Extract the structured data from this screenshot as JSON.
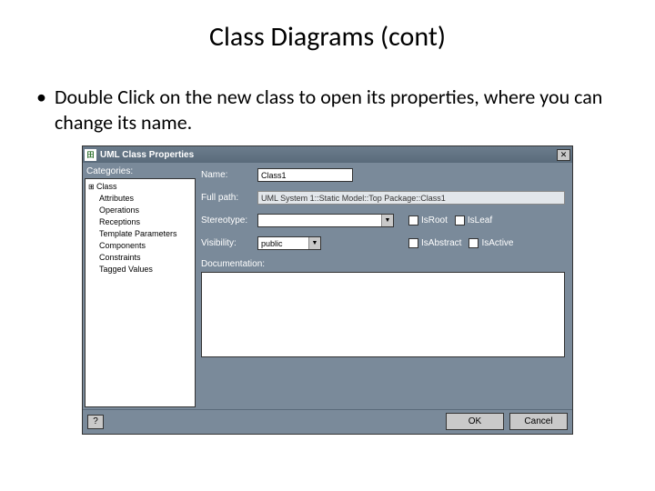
{
  "slide": {
    "title": "Class Diagrams (cont)",
    "bullet": "Double Click on the new class to open its properties, where you can change its name."
  },
  "dialog": {
    "title": "UML Class Properties",
    "categories_label": "Categories:",
    "categories": [
      "Class",
      "Attributes",
      "Operations",
      "Receptions",
      "Template Parameters",
      "Components",
      "Constraints",
      "Tagged Values"
    ],
    "form": {
      "name_label": "Name:",
      "name_value": "Class1",
      "fullpath_label": "Full path:",
      "fullpath_value": "UML System 1::Static Model::Top Package::Class1",
      "stereotype_label": "Stereotype:",
      "stereotype_value": "",
      "visibility_label": "Visibility:",
      "visibility_value": "public",
      "checkboxes": {
        "isRoot": "IsRoot",
        "isLeaf": "IsLeaf",
        "isAbstract": "IsAbstract",
        "isActive": "IsActive"
      },
      "documentation_label": "Documentation:"
    },
    "buttons": {
      "ok": "OK",
      "cancel": "Cancel"
    }
  }
}
